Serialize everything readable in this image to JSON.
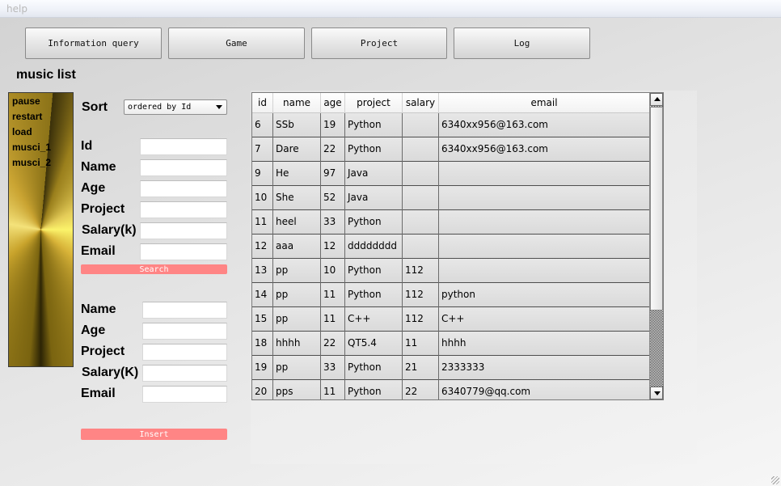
{
  "menubar": {
    "help_label": "help"
  },
  "toolbar": {
    "buttons": [
      "Information query",
      "Game",
      "Project",
      "Log"
    ]
  },
  "music": {
    "title": "music list",
    "items": [
      "pause",
      "restart",
      "load",
      "musci_1",
      "musci_2"
    ]
  },
  "query_form": {
    "sort_label": "Sort",
    "sort_value": "ordered by Id",
    "labels": [
      "Id",
      "Name",
      "Age",
      "Project",
      "Salary(k)",
      "Email"
    ],
    "search_label": "Search"
  },
  "insert_form": {
    "labels": [
      "Name",
      "Age",
      "Project",
      "Salary(K)",
      "Email"
    ],
    "insert_label": "Insert"
  },
  "table": {
    "columns": [
      "id",
      "name",
      "age",
      "project",
      "salary",
      "email"
    ],
    "rows": [
      [
        "6",
        "SSb",
        "19",
        "Python",
        "",
        "6340xx956@163.com"
      ],
      [
        "7",
        "Dare",
        "22",
        "Python",
        "",
        "6340xx956@163.com"
      ],
      [
        "9",
        "He",
        "97",
        "Java",
        "",
        ""
      ],
      [
        "10",
        "She",
        "52",
        "Java",
        "",
        ""
      ],
      [
        "11",
        "heel",
        "33",
        "Python",
        "",
        ""
      ],
      [
        "12",
        "aaa",
        "12",
        "dddddddd",
        "",
        ""
      ],
      [
        "13",
        "pp",
        "10",
        "Python",
        "112",
        ""
      ],
      [
        "14",
        "pp",
        "11",
        "Python",
        "112",
        "python"
      ],
      [
        "15",
        "pp",
        "11",
        "C++",
        "112",
        "C++"
      ],
      [
        "18",
        "hhhh",
        "22",
        "QT5.4",
        "11",
        "hhhh"
      ],
      [
        "19",
        "pp",
        "33",
        "Python",
        "21",
        "2333333"
      ],
      [
        "20",
        "pps",
        "11",
        "Python",
        "22",
        "6340779@qq.com"
      ]
    ]
  }
}
